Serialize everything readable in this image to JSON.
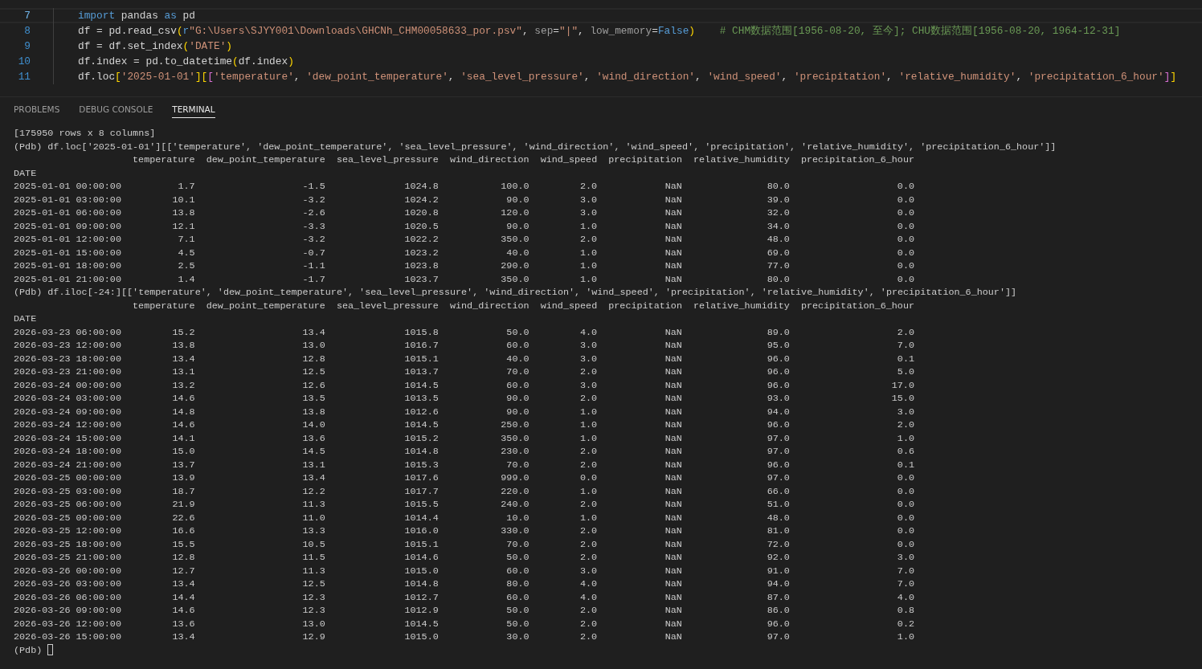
{
  "editor": {
    "lines": [
      {
        "number": "7",
        "current": true,
        "tokens": [
          {
            "kind": "keyword",
            "text": "import"
          },
          {
            "kind": "plain",
            "text": " pandas "
          },
          {
            "kind": "keyword",
            "text": "as"
          },
          {
            "kind": "plain",
            "text": " pd"
          }
        ]
      },
      {
        "number": "8",
        "current": false,
        "tokens": [
          {
            "kind": "plain",
            "text": "df = pd.read_csv"
          },
          {
            "kind": "bracket1",
            "text": "("
          },
          {
            "kind": "prefix",
            "text": "r"
          },
          {
            "kind": "string",
            "text": "\"G:\\Users\\SJYY001\\Downloads\\GHCNh_CHM00058633_por.psv\""
          },
          {
            "kind": "plain",
            "text": ", "
          },
          {
            "kind": "param",
            "text": "sep"
          },
          {
            "kind": "plain",
            "text": "="
          },
          {
            "kind": "string",
            "text": "\"|\""
          },
          {
            "kind": "plain",
            "text": ", "
          },
          {
            "kind": "param",
            "text": "low_memory"
          },
          {
            "kind": "plain",
            "text": "="
          },
          {
            "kind": "constant",
            "text": "False"
          },
          {
            "kind": "bracket1",
            "text": ")"
          },
          {
            "kind": "comment",
            "text": "# CHM数据范围[1956-08-20, 至今]; CHU数据范围[1956-08-20, 1964-12-31]"
          }
        ]
      },
      {
        "number": "9",
        "current": false,
        "tokens": [
          {
            "kind": "plain",
            "text": "df = df.set_index"
          },
          {
            "kind": "bracket1",
            "text": "("
          },
          {
            "kind": "string",
            "text": "'DATE'"
          },
          {
            "kind": "bracket1",
            "text": ")"
          }
        ]
      },
      {
        "number": "10",
        "current": false,
        "tokens": [
          {
            "kind": "plain",
            "text": "df.index = pd.to_datetime"
          },
          {
            "kind": "bracket1",
            "text": "("
          },
          {
            "kind": "plain",
            "text": "df.index"
          },
          {
            "kind": "bracket1",
            "text": ")"
          }
        ]
      },
      {
        "number": "11",
        "current": false,
        "tokens": [
          {
            "kind": "plain",
            "text": "df.loc"
          },
          {
            "kind": "bracket1",
            "text": "["
          },
          {
            "kind": "string",
            "text": "'2025-01-01'"
          },
          {
            "kind": "bracket1",
            "text": "]"
          },
          {
            "kind": "bracket1",
            "text": "["
          },
          {
            "kind": "bracket2",
            "text": "["
          },
          {
            "kind": "string",
            "text": "'temperature'"
          },
          {
            "kind": "plain",
            "text": ", "
          },
          {
            "kind": "string",
            "text": "'dew_point_temperature'"
          },
          {
            "kind": "plain",
            "text": ", "
          },
          {
            "kind": "string",
            "text": "'sea_level_pressure'"
          },
          {
            "kind": "plain",
            "text": ", "
          },
          {
            "kind": "string",
            "text": "'wind_direction'"
          },
          {
            "kind": "plain",
            "text": ", "
          },
          {
            "kind": "string",
            "text": "'wind_speed'"
          },
          {
            "kind": "plain",
            "text": ", "
          },
          {
            "kind": "string",
            "text": "'precipitation'"
          },
          {
            "kind": "plain",
            "text": ", "
          },
          {
            "kind": "string",
            "text": "'relative_humidity'"
          },
          {
            "kind": "plain",
            "text": ", "
          },
          {
            "kind": "string",
            "text": "'precipitation_6_hour'"
          },
          {
            "kind": "bracket2",
            "text": "]"
          },
          {
            "kind": "bracket1",
            "text": "]"
          }
        ]
      }
    ]
  },
  "panel_tabs": [
    {
      "label": "PROBLEMS",
      "selected": false
    },
    {
      "label": "DEBUG CONSOLE",
      "selected": false
    },
    {
      "label": "TERMINAL",
      "selected": true
    }
  ],
  "terminal": {
    "blocks": [
      {
        "kind": "text",
        "text": "[175950 rows x 8 columns]"
      },
      {
        "kind": "text",
        "text": "(Pdb) df.loc['2025-01-01'][['temperature', 'dew_point_temperature', 'sea_level_pressure', 'wind_direction', 'wind_speed', 'precipitation', 'relative_humidity', 'precipitation_6_hour']]"
      },
      {
        "kind": "table",
        "index_name": "DATE",
        "columns": [
          "temperature",
          "dew_point_temperature",
          "sea_level_pressure",
          "wind_direction",
          "wind_speed",
          "precipitation",
          "relative_humidity",
          "precipitation_6_hour"
        ],
        "rows": [
          {
            "index": "2025-01-01 00:00:00",
            "values": [
              "1.7",
              "-1.5",
              "1024.8",
              "100.0",
              "2.0",
              "NaN",
              "80.0",
              "0.0"
            ]
          },
          {
            "index": "2025-01-01 03:00:00",
            "values": [
              "10.1",
              "-3.2",
              "1024.2",
              "90.0",
              "3.0",
              "NaN",
              "39.0",
              "0.0"
            ]
          },
          {
            "index": "2025-01-01 06:00:00",
            "values": [
              "13.8",
              "-2.6",
              "1020.8",
              "120.0",
              "3.0",
              "NaN",
              "32.0",
              "0.0"
            ]
          },
          {
            "index": "2025-01-01 09:00:00",
            "values": [
              "12.1",
              "-3.3",
              "1020.5",
              "90.0",
              "1.0",
              "NaN",
              "34.0",
              "0.0"
            ]
          },
          {
            "index": "2025-01-01 12:00:00",
            "values": [
              "7.1",
              "-3.2",
              "1022.2",
              "350.0",
              "2.0",
              "NaN",
              "48.0",
              "0.0"
            ]
          },
          {
            "index": "2025-01-01 15:00:00",
            "values": [
              "4.5",
              "-0.7",
              "1023.2",
              "40.0",
              "1.0",
              "NaN",
              "69.0",
              "0.0"
            ]
          },
          {
            "index": "2025-01-01 18:00:00",
            "values": [
              "2.5",
              "-1.1",
              "1023.8",
              "290.0",
              "1.0",
              "NaN",
              "77.0",
              "0.0"
            ]
          },
          {
            "index": "2025-01-01 21:00:00",
            "values": [
              "1.4",
              "-1.7",
              "1023.7",
              "350.0",
              "1.0",
              "NaN",
              "80.0",
              "0.0"
            ]
          }
        ]
      },
      {
        "kind": "text",
        "text": "(Pdb) df.iloc[-24:][['temperature', 'dew_point_temperature', 'sea_level_pressure', 'wind_direction', 'wind_speed', 'precipitation', 'relative_humidity', 'precipitation_6_hour']]"
      },
      {
        "kind": "table",
        "index_name": "DATE",
        "columns": [
          "temperature",
          "dew_point_temperature",
          "sea_level_pressure",
          "wind_direction",
          "wind_speed",
          "precipitation",
          "relative_humidity",
          "precipitation_6_hour"
        ],
        "rows": [
          {
            "index": "2026-03-23 06:00:00",
            "values": [
              "15.2",
              "13.4",
              "1015.8",
              "50.0",
              "4.0",
              "NaN",
              "89.0",
              "2.0"
            ]
          },
          {
            "index": "2026-03-23 12:00:00",
            "values": [
              "13.8",
              "13.0",
              "1016.7",
              "60.0",
              "3.0",
              "NaN",
              "95.0",
              "7.0"
            ]
          },
          {
            "index": "2026-03-23 18:00:00",
            "values": [
              "13.4",
              "12.8",
              "1015.1",
              "40.0",
              "3.0",
              "NaN",
              "96.0",
              "0.1"
            ]
          },
          {
            "index": "2026-03-23 21:00:00",
            "values": [
              "13.1",
              "12.5",
              "1013.7",
              "70.0",
              "2.0",
              "NaN",
              "96.0",
              "5.0"
            ]
          },
          {
            "index": "2026-03-24 00:00:00",
            "values": [
              "13.2",
              "12.6",
              "1014.5",
              "60.0",
              "3.0",
              "NaN",
              "96.0",
              "17.0"
            ]
          },
          {
            "index": "2026-03-24 03:00:00",
            "values": [
              "14.6",
              "13.5",
              "1013.5",
              "90.0",
              "2.0",
              "NaN",
              "93.0",
              "15.0"
            ]
          },
          {
            "index": "2026-03-24 09:00:00",
            "values": [
              "14.8",
              "13.8",
              "1012.6",
              "90.0",
              "1.0",
              "NaN",
              "94.0",
              "3.0"
            ]
          },
          {
            "index": "2026-03-24 12:00:00",
            "values": [
              "14.6",
              "14.0",
              "1014.5",
              "250.0",
              "1.0",
              "NaN",
              "96.0",
              "2.0"
            ]
          },
          {
            "index": "2026-03-24 15:00:00",
            "values": [
              "14.1",
              "13.6",
              "1015.2",
              "350.0",
              "1.0",
              "NaN",
              "97.0",
              "1.0"
            ]
          },
          {
            "index": "2026-03-24 18:00:00",
            "values": [
              "15.0",
              "14.5",
              "1014.8",
              "230.0",
              "2.0",
              "NaN",
              "97.0",
              "0.6"
            ]
          },
          {
            "index": "2026-03-24 21:00:00",
            "values": [
              "13.7",
              "13.1",
              "1015.3",
              "70.0",
              "2.0",
              "NaN",
              "96.0",
              "0.1"
            ]
          },
          {
            "index": "2026-03-25 00:00:00",
            "values": [
              "13.9",
              "13.4",
              "1017.6",
              "999.0",
              "0.0",
              "NaN",
              "97.0",
              "0.0"
            ]
          },
          {
            "index": "2026-03-25 03:00:00",
            "values": [
              "18.7",
              "12.2",
              "1017.7",
              "220.0",
              "1.0",
              "NaN",
              "66.0",
              "0.0"
            ]
          },
          {
            "index": "2026-03-25 06:00:00",
            "values": [
              "21.9",
              "11.3",
              "1015.5",
              "240.0",
              "2.0",
              "NaN",
              "51.0",
              "0.0"
            ]
          },
          {
            "index": "2026-03-25 09:00:00",
            "values": [
              "22.6",
              "11.0",
              "1014.4",
              "10.0",
              "1.0",
              "NaN",
              "48.0",
              "0.0"
            ]
          },
          {
            "index": "2026-03-25 12:00:00",
            "values": [
              "16.6",
              "13.3",
              "1016.0",
              "330.0",
              "2.0",
              "NaN",
              "81.0",
              "0.0"
            ]
          },
          {
            "index": "2026-03-25 18:00:00",
            "values": [
              "15.5",
              "10.5",
              "1015.1",
              "70.0",
              "2.0",
              "NaN",
              "72.0",
              "0.0"
            ]
          },
          {
            "index": "2026-03-25 21:00:00",
            "values": [
              "12.8",
              "11.5",
              "1014.6",
              "50.0",
              "2.0",
              "NaN",
              "92.0",
              "3.0"
            ]
          },
          {
            "index": "2026-03-26 00:00:00",
            "values": [
              "12.7",
              "11.3",
              "1015.0",
              "60.0",
              "3.0",
              "NaN",
              "91.0",
              "7.0"
            ]
          },
          {
            "index": "2026-03-26 03:00:00",
            "values": [
              "13.4",
              "12.5",
              "1014.8",
              "80.0",
              "4.0",
              "NaN",
              "94.0",
              "7.0"
            ]
          },
          {
            "index": "2026-03-26 06:00:00",
            "values": [
              "14.4",
              "12.3",
              "1012.7",
              "60.0",
              "4.0",
              "NaN",
              "87.0",
              "4.0"
            ]
          },
          {
            "index": "2026-03-26 09:00:00",
            "values": [
              "14.6",
              "12.3",
              "1012.9",
              "50.0",
              "2.0",
              "NaN",
              "86.0",
              "0.8"
            ]
          },
          {
            "index": "2026-03-26 12:00:00",
            "values": [
              "13.6",
              "13.0",
              "1014.5",
              "50.0",
              "2.0",
              "NaN",
              "96.0",
              "0.2"
            ]
          },
          {
            "index": "2026-03-26 15:00:00",
            "values": [
              "13.4",
              "12.9",
              "1015.0",
              "30.0",
              "2.0",
              "NaN",
              "97.0",
              "1.0"
            ]
          }
        ]
      },
      {
        "kind": "prompt",
        "text": "(Pdb)"
      }
    ]
  }
}
